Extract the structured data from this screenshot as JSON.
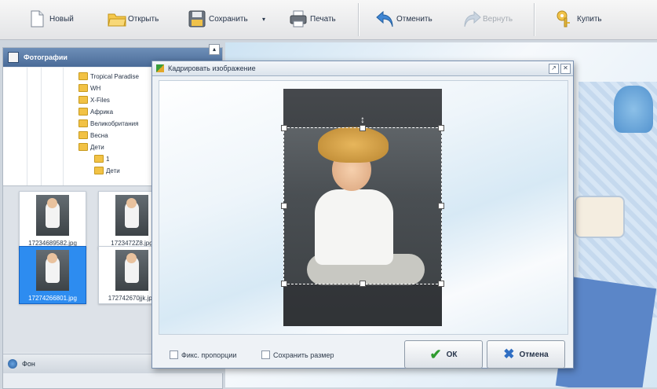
{
  "toolbar": {
    "new": "Новый",
    "open": "Открыть",
    "save": "Сохранить",
    "print": "Печать",
    "undo": "Отменить",
    "redo": "Вернуть",
    "buy": "Купить"
  },
  "panel": {
    "title": "Фотографии",
    "tree": [
      {
        "label": "Tropical Paradise",
        "level": 1
      },
      {
        "label": "WH",
        "level": 1
      },
      {
        "label": "X-Files",
        "level": 1
      },
      {
        "label": "Африка",
        "level": 1
      },
      {
        "label": "Великобритания",
        "level": 1
      },
      {
        "label": "Весна",
        "level": 1
      },
      {
        "label": "Дети",
        "level": 1
      },
      {
        "label": "1",
        "level": 2
      },
      {
        "label": "Дети",
        "level": 2
      }
    ],
    "thumbs": [
      {
        "label": "17234689582.jpg",
        "selected": false
      },
      {
        "label": "1723472Z8.jpg",
        "selected": false
      },
      {
        "label": "17274266801.jpg",
        "selected": true
      },
      {
        "label": "172742670jjk.jpg",
        "selected": false
      }
    ],
    "footer": "Фон"
  },
  "dialog": {
    "title": "Кадрировать изображение",
    "fix_proportions": "Фикс. пропорции",
    "keep_size": "Сохранить размер",
    "ok": "ОК",
    "cancel": "Отмена"
  },
  "colors": {
    "accent": "#2d8cf0",
    "panel_header": "#4a6b98"
  }
}
